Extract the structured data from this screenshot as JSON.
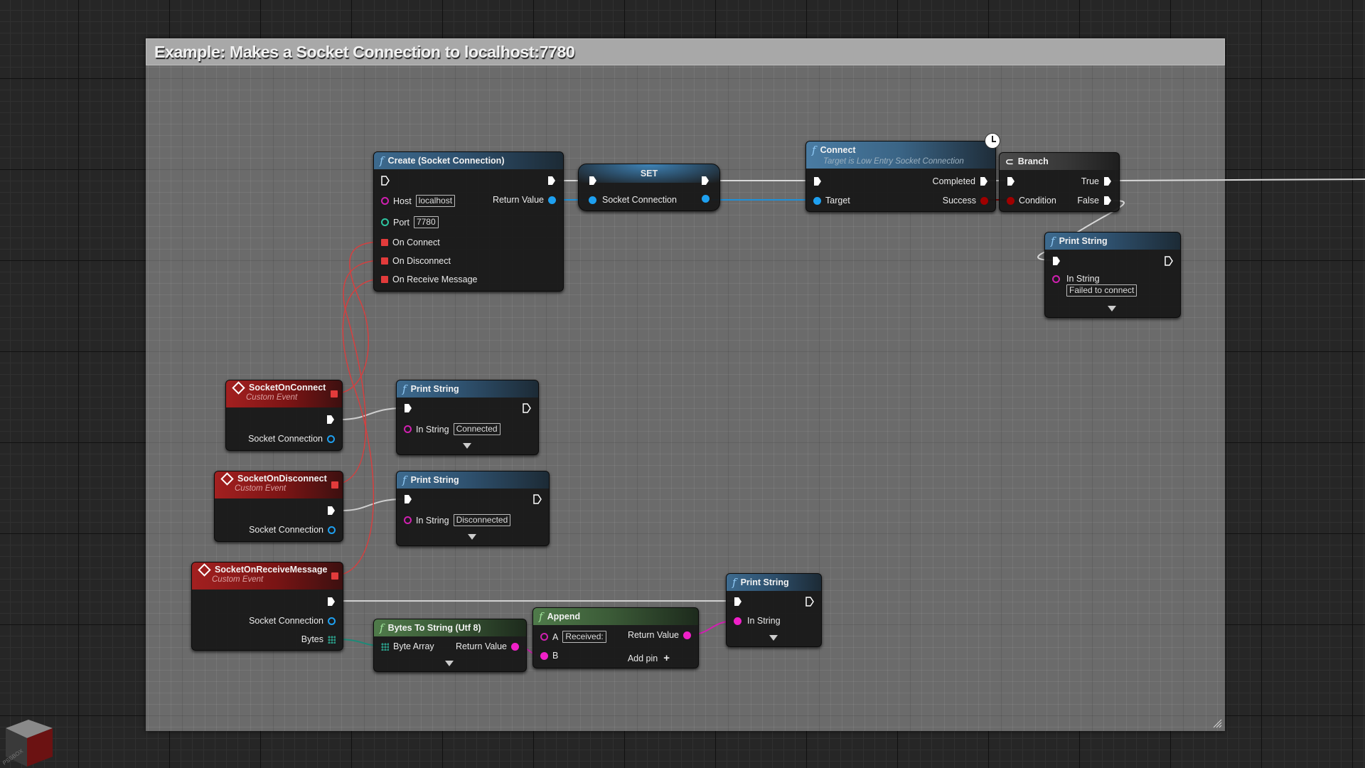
{
  "comment": {
    "title": "Example: Makes a Socket Connection to localhost:7780"
  },
  "nodes": {
    "create_socket": {
      "title": "Create (Socket Connection)",
      "host_label": "Host",
      "host_value": "localhost",
      "port_label": "Port",
      "port_value": "7780",
      "return_label": "Return Value",
      "on_connect": "On Connect",
      "on_disconnect": "On Disconnect",
      "on_receive": "On Receive Message"
    },
    "set": {
      "title": "SET",
      "var_label": "Socket Connection"
    },
    "connect": {
      "title": "Connect",
      "subtitle": "Target is Low Entry Socket Connection",
      "completed_label": "Completed",
      "target_label": "Target",
      "success_label": "Success"
    },
    "branch": {
      "title": "Branch",
      "true_label": "True",
      "condition_label": "Condition",
      "false_label": "False"
    },
    "print_failed": {
      "title": "Print String",
      "in_label": "In String",
      "in_value": "Failed to connect"
    },
    "on_connect_event": {
      "title": "SocketOnConnect",
      "subtitle": "Custom Event",
      "out_label": "Socket Connection"
    },
    "print_connected": {
      "title": "Print String",
      "in_label": "In String",
      "in_value": "Connected"
    },
    "on_disconnect_event": {
      "title": "SocketOnDisconnect",
      "subtitle": "Custom Event",
      "out_label": "Socket Connection"
    },
    "print_disconnected": {
      "title": "Print String",
      "in_label": "In String",
      "in_value": "Disconnected"
    },
    "on_receive_event": {
      "title": "SocketOnReceiveMessage",
      "subtitle": "Custom Event",
      "out_label": "Socket Connection",
      "bytes_label": "Bytes"
    },
    "bytes_to_string": {
      "title": "Bytes To String (Utf 8)",
      "in_label": "Byte Array",
      "return_label": "Return Value"
    },
    "append": {
      "title": "Append",
      "a_label": "A",
      "a_value": "Received:",
      "b_label": "B",
      "return_label": "Return Value",
      "add_pin_label": "Add pin"
    },
    "print_received": {
      "title": "Print String",
      "in_label": "In String"
    }
  },
  "colors": {
    "exec_wire": "#d8d8d8",
    "object_pin": "#1ea0f0",
    "string_pin": "#f020c8",
    "bool_pin": "#a00000",
    "delegate_pin": "#e23b3b",
    "byte_pin": "#2a9a86",
    "int_pin": "#2ec4a0"
  },
  "watermark": "PSSBOX"
}
